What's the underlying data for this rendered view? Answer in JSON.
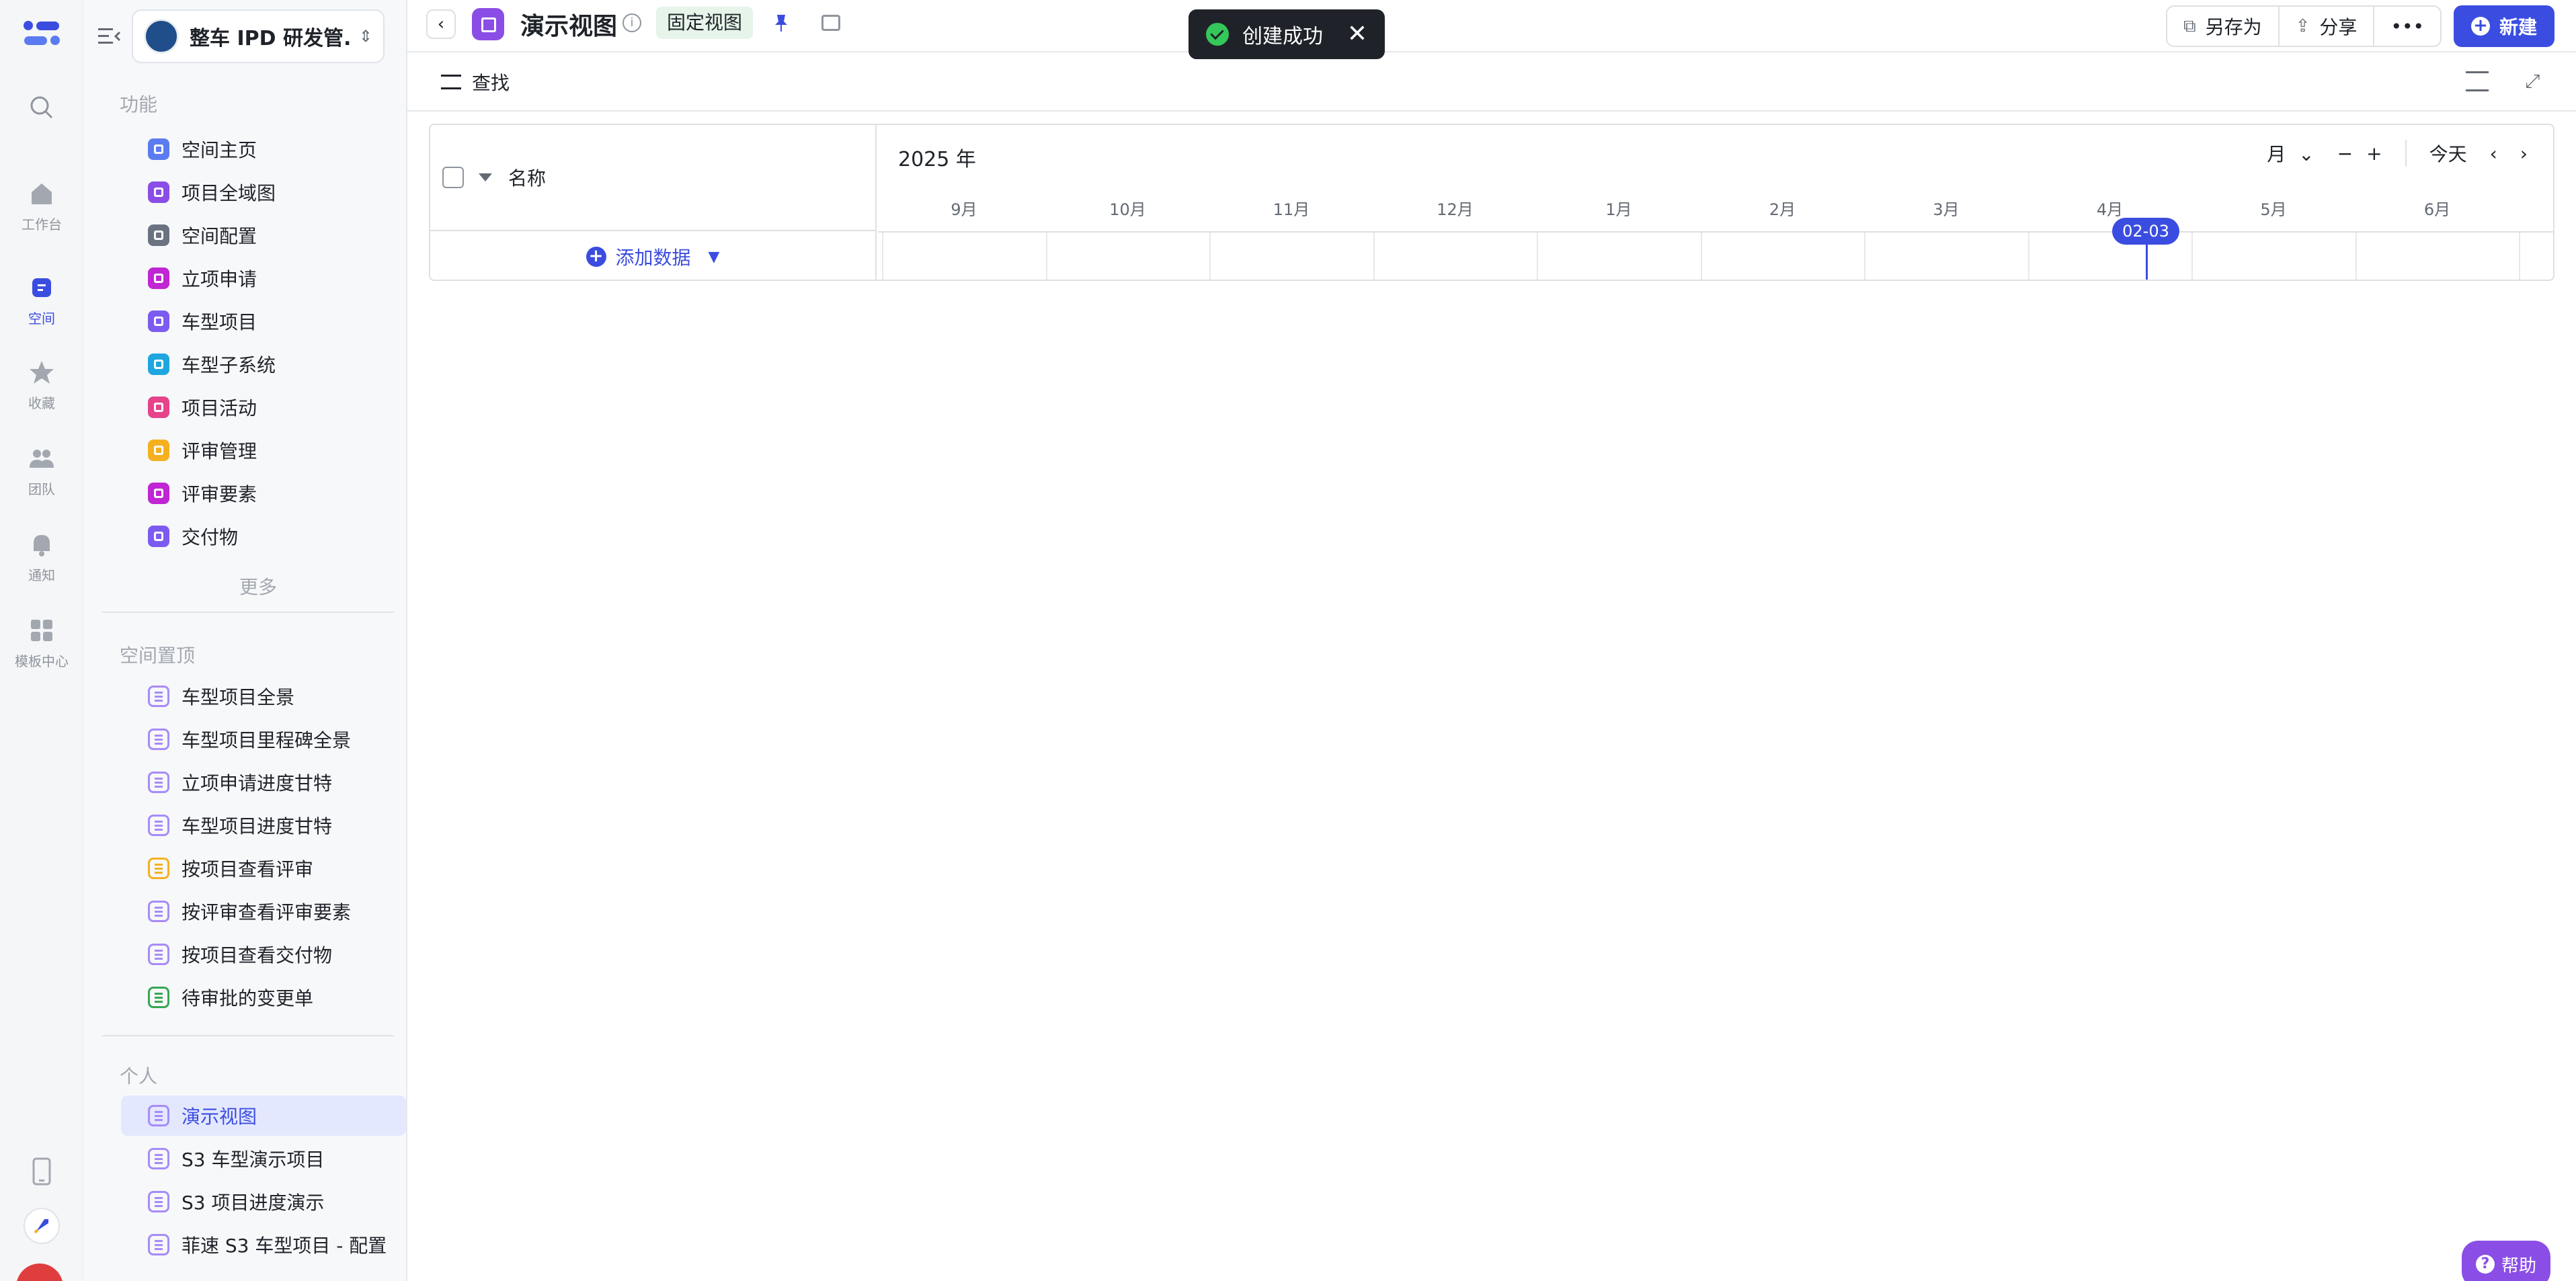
{
  "rail": {
    "items": [
      {
        "label": "",
        "icon": "search-icon"
      },
      {
        "label": "工作台",
        "icon": "home-icon"
      },
      {
        "label": "空间",
        "icon": "space-icon"
      },
      {
        "label": "收藏",
        "icon": "star-icon"
      },
      {
        "label": "团队",
        "icon": "team-icon"
      },
      {
        "label": "通知",
        "icon": "bell-icon"
      },
      {
        "label": "模板中心",
        "icon": "template-icon"
      }
    ]
  },
  "sidebar": {
    "space_name": "整车 IPD 研发管...",
    "section_features": "功能",
    "features": [
      {
        "label": "空间主页",
        "color": "#5b7bf0"
      },
      {
        "label": "项目全域图",
        "color": "#8a4ee6"
      },
      {
        "label": "空间配置",
        "color": "#6b7280"
      },
      {
        "label": "立项申请",
        "color": "#c026d3"
      },
      {
        "label": "车型项目",
        "color": "#7c5cf0"
      },
      {
        "label": "车型子系统",
        "color": "#1fa6e0"
      },
      {
        "label": "项目活动",
        "color": "#e6438a"
      },
      {
        "label": "评审管理",
        "color": "#f5b020"
      },
      {
        "label": "评审要素",
        "color": "#c026d3"
      },
      {
        "label": "交付物",
        "color": "#7c5cf0"
      }
    ],
    "more": "更多",
    "section_pinned": "空间置顶",
    "pinned": [
      {
        "label": "车型项目全景",
        "color": "#a78bfa"
      },
      {
        "label": "车型项目里程碑全景",
        "color": "#a78bfa"
      },
      {
        "label": "立项申请进度甘特",
        "color": "#a78bfa"
      },
      {
        "label": "车型项目进度甘特",
        "color": "#a78bfa"
      },
      {
        "label": "按项目查看评审",
        "color": "#f5b020"
      },
      {
        "label": "按评审查看评审要素",
        "color": "#a78bfa"
      },
      {
        "label": "按项目查看交付物",
        "color": "#a78bfa"
      },
      {
        "label": "待审批的变更单",
        "color": "#34a853"
      }
    ],
    "section_personal": "个人",
    "personal": [
      {
        "label": "演示视图",
        "color": "#a78bfa"
      },
      {
        "label": "S3 车型演示项目",
        "color": "#a78bfa"
      },
      {
        "label": "S3 项目进度演示",
        "color": "#a78bfa"
      },
      {
        "label": "菲速 S3 车型项目 - 配置",
        "color": "#a78bfa"
      }
    ]
  },
  "topbar": {
    "title": "演示视图",
    "badge": "固定视图",
    "save_as": "另存为",
    "share": "分享",
    "more": "•••",
    "new": "新建"
  },
  "toast": {
    "text": "创建成功"
  },
  "toolbar": {
    "find": "查找"
  },
  "gantt": {
    "name_header": "名称",
    "add_data": "添加数据",
    "year": "2025 年",
    "scale": "月",
    "today": "今天",
    "today_marker": "02-03",
    "months": [
      "9月",
      "10月",
      "11月",
      "12月",
      "1月",
      "2月",
      "3月",
      "4月",
      "5月",
      "6月"
    ]
  },
  "help": {
    "label": "帮助"
  },
  "colors": {
    "accent": "#3b4de0",
    "help": "#8a4ee6"
  }
}
